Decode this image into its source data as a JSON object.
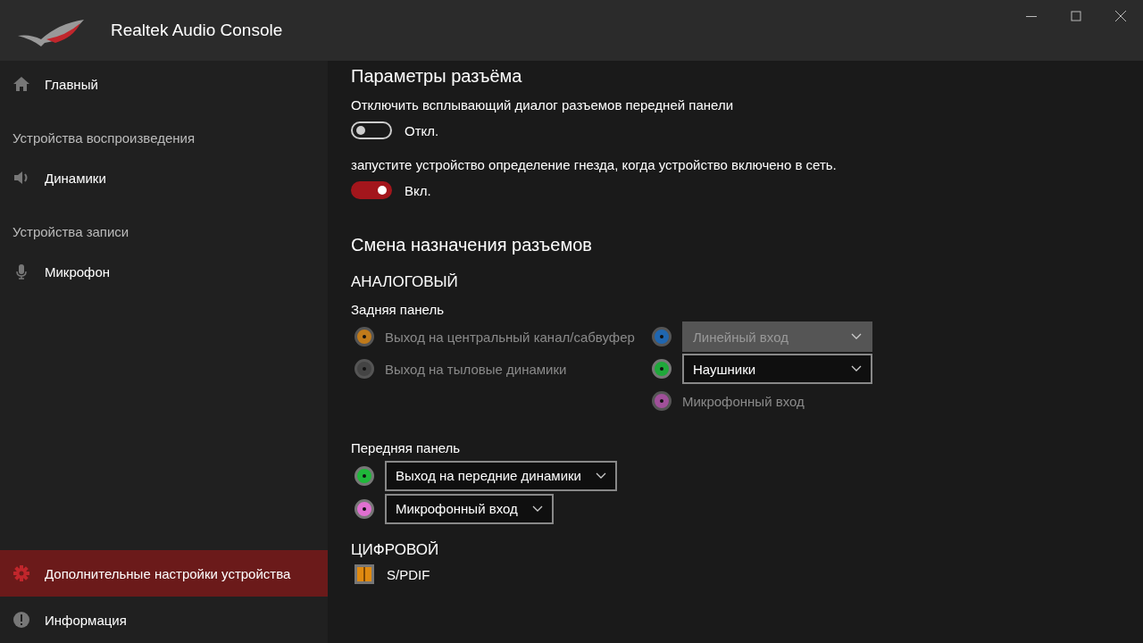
{
  "window": {
    "title": "Realtek Audio Console"
  },
  "sidebar": {
    "items": [
      {
        "kind": "item",
        "label": "Главный",
        "selected": false
      },
      {
        "kind": "header",
        "label": "Устройства воспроизведения"
      },
      {
        "kind": "item",
        "label": "Динамики",
        "selected": false
      },
      {
        "kind": "header",
        "label": "Устройства записи"
      },
      {
        "kind": "item",
        "label": "Микрофон",
        "selected": false
      }
    ],
    "bottom_items": [
      {
        "label": "Дополнительные настройки устройства",
        "selected": true
      },
      {
        "label": "Информация",
        "selected": false
      }
    ]
  },
  "jack_settings": {
    "title": "Параметры разъёма",
    "toggles": [
      {
        "label": "Отключить всплывающий диалог разъемов передней панели",
        "on": false,
        "state_text": "Откл."
      },
      {
        "label": "запустите устройство определение гнезда, когда  устройство включено в сеть.",
        "on": true,
        "state_text": "Вкл."
      }
    ]
  },
  "retasking": {
    "title": "Смена назначения разъемов",
    "analog_title": "АНАЛОГОВЫЙ",
    "rear_panel": {
      "title": "Задняя панель",
      "left_jacks": [
        {
          "color": "#c07a1a",
          "kind": "label",
          "label": "Выход на центральный канал/сабвуфер",
          "disabled": true
        },
        {
          "color": "#444444",
          "kind": "label",
          "label": "Выход на тыловые динамики",
          "disabled": true
        }
      ],
      "right_jacks": [
        {
          "color": "#1f66b0",
          "kind": "dropdown",
          "label": "Линейный вход",
          "disabled": true
        },
        {
          "color": "#1fa83a",
          "kind": "dropdown",
          "label": "Наушники",
          "disabled": false
        },
        {
          "color": "#a0509a",
          "kind": "label",
          "label": "Микрофонный вход",
          "disabled": true
        }
      ]
    },
    "front_panel": {
      "title": "Передняя панель",
      "jacks": [
        {
          "color": "#1fb83a",
          "kind": "dropdown",
          "label": "Выход на передние динамики",
          "disabled": false
        },
        {
          "color": "#e070d0",
          "kind": "dropdown",
          "label": "Микрофонный вход",
          "disabled": false
        }
      ]
    },
    "digital_title": "ЦИФРОВОЙ",
    "digital": [
      {
        "label": "S/PDIF"
      }
    ]
  }
}
